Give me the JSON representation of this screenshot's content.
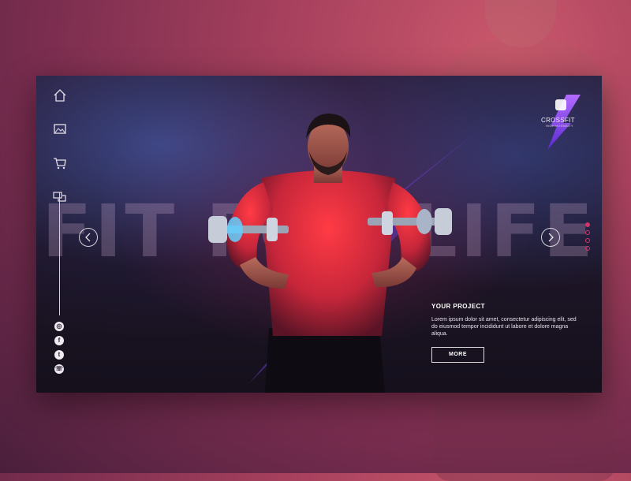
{
  "hero": {
    "title": "FIT FOR LIFE"
  },
  "logo": {
    "title": "CROSSFIT",
    "subtitle": "HIGH INTENSITY",
    "icon": "fist-bolt-icon"
  },
  "nav": {
    "items": [
      {
        "name": "home",
        "icon": "home-icon"
      },
      {
        "name": "gallery",
        "icon": "image-icon"
      },
      {
        "name": "shop",
        "icon": "cart-icon"
      },
      {
        "name": "chat",
        "icon": "chat-icon"
      }
    ]
  },
  "social": {
    "items": [
      {
        "name": "instagram",
        "icon": "instagram-icon",
        "glyph": "◎"
      },
      {
        "name": "facebook",
        "icon": "facebook-icon",
        "glyph": "f"
      },
      {
        "name": "twitter",
        "icon": "twitter-icon",
        "glyph": "t"
      },
      {
        "name": "whatsapp",
        "icon": "whatsapp-icon",
        "glyph": "☏"
      }
    ]
  },
  "project": {
    "heading": "YOUR PROJECT",
    "body": "Lorem ipsum dolor sit amet, consectetur adipiscing elit, sed do eiusmod tempor incididunt ut labore et dolore magna aliqua.",
    "button_label": "MORE"
  },
  "pager": {
    "total": 4,
    "active_index": 0
  },
  "colors": {
    "accent": "#d6336c",
    "bolt": "#7a3ff0",
    "shirt": "#e0303a"
  }
}
